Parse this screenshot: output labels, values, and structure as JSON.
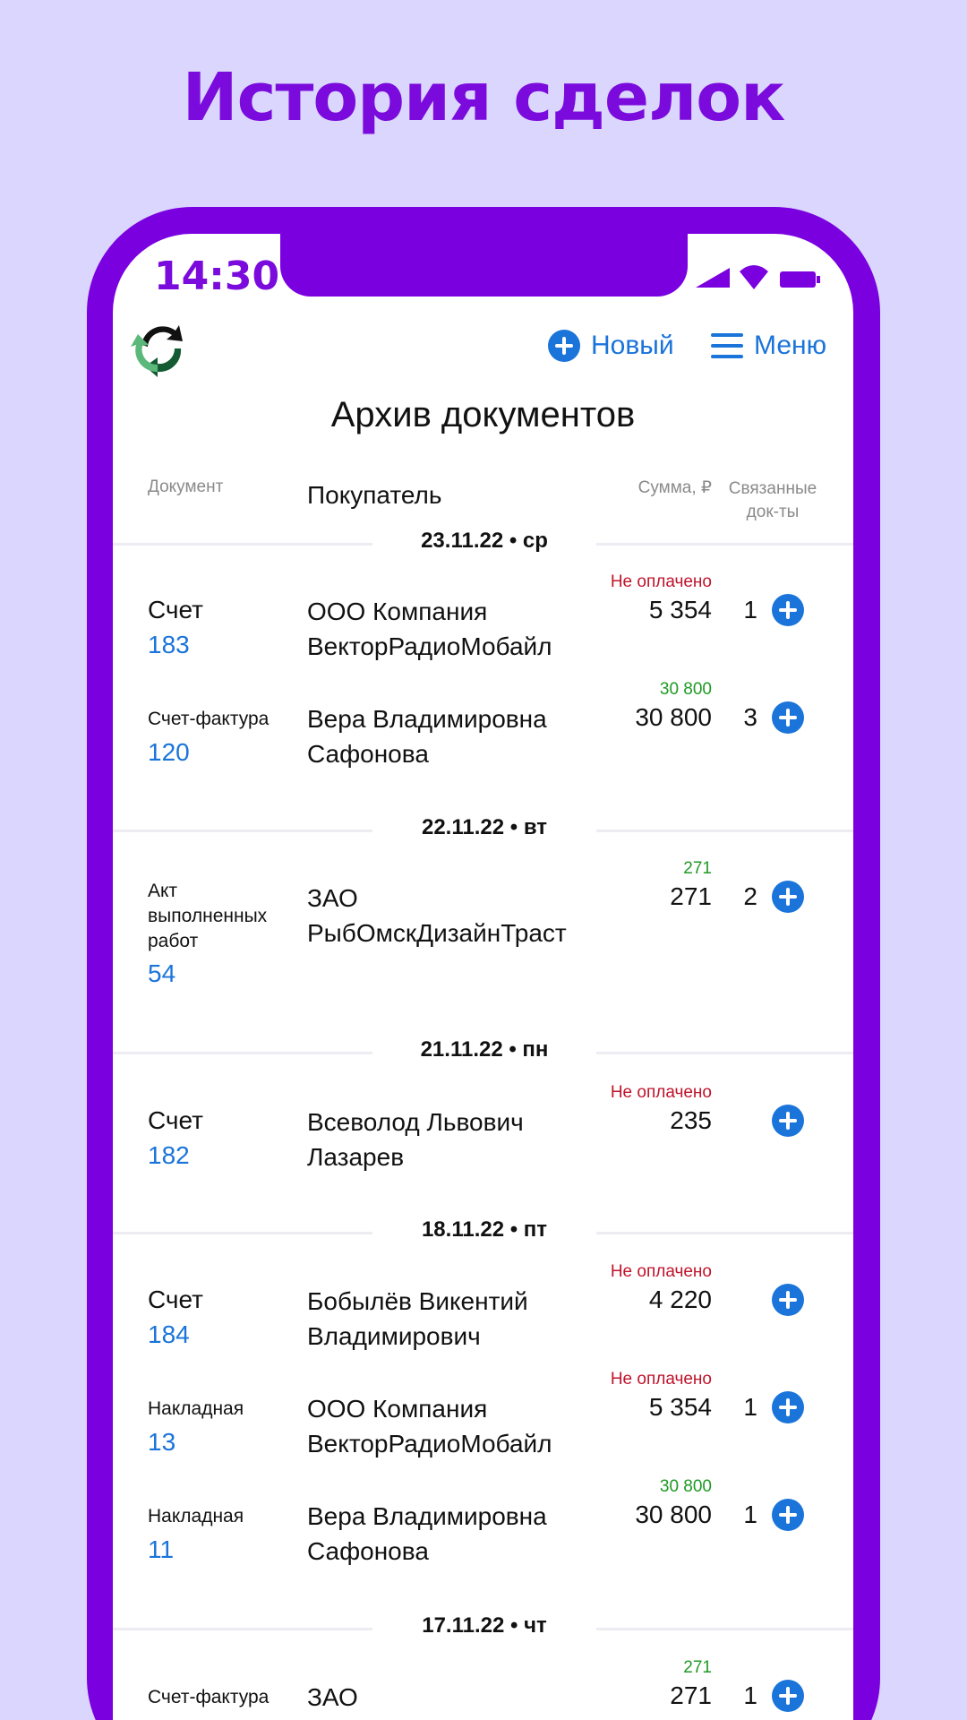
{
  "headline": "История сделок",
  "status_bar": {
    "time": "14:30"
  },
  "toolbar": {
    "new_label": "Новый",
    "menu_label": "Меню"
  },
  "page": {
    "title": "Архив документов"
  },
  "columns": {
    "document": "Документ",
    "buyer": "Покупатель",
    "sum": "Сумма, ₽",
    "linked_line1": "Связанные",
    "linked_line2": "док-ты"
  },
  "colors": {
    "accent": "#7a00e0",
    "link": "#1a74d9",
    "unpaid": "#c0142c",
    "paid": "#1f9a24",
    "background": "#dad6fd"
  },
  "groups": [
    {
      "date": "23.11.22 • ср",
      "rows": [
        {
          "type": "Счет",
          "number": "183",
          "buyer_line1": "ООО Компания",
          "buyer_line2": "ВекторРадиоМобайл",
          "status": "Не оплачено",
          "amount": "5 354",
          "linked": "1"
        },
        {
          "type": "Счет-фактура",
          "number": "120",
          "buyer_line1": "Вера Владимировна",
          "buyer_line2": "Сафонова",
          "status": "30 800",
          "amount": "30 800",
          "linked": "3"
        }
      ]
    },
    {
      "date": "22.11.22 • вт",
      "rows": [
        {
          "type_line1": "Акт",
          "type_line2": "выполненных",
          "type_line3": "работ",
          "number": "54",
          "buyer_line1": "ЗАО",
          "buyer_line2": "РыбОмскДизайнТраст",
          "status": "271",
          "amount": "271",
          "linked": "2"
        }
      ]
    },
    {
      "date": "21.11.22 • пн",
      "rows": [
        {
          "type": "Счет",
          "number": "182",
          "buyer_line1": "Всеволод Львович",
          "buyer_line2": "Лазарев",
          "status": "Не оплачено",
          "amount": "235",
          "linked": ""
        }
      ]
    },
    {
      "date": "18.11.22 • пт",
      "rows": [
        {
          "type": "Счет",
          "number": "184",
          "buyer_line1": "Бобылёв Викентий",
          "buyer_line2": "Владимирович",
          "status": "Не оплачено",
          "amount": "4 220",
          "linked": ""
        },
        {
          "type": "Накладная",
          "number": "13",
          "buyer_line1": "ООО Компания",
          "buyer_line2": "ВекторРадиоМобайл",
          "status": "Не оплачено",
          "amount": "5 354",
          "linked": "1"
        },
        {
          "type": "Накладная",
          "number": "11",
          "buyer_line1": "Вера Владимировна",
          "buyer_line2": "Сафонова",
          "status": "30 800",
          "amount": "30 800",
          "linked": "1"
        }
      ]
    },
    {
      "date": "17.11.22 • чт",
      "rows": [
        {
          "type": "Счет-фактура",
          "buyer_line1": "ЗАО",
          "status": "271",
          "amount": "271",
          "linked": "1"
        }
      ]
    }
  ]
}
